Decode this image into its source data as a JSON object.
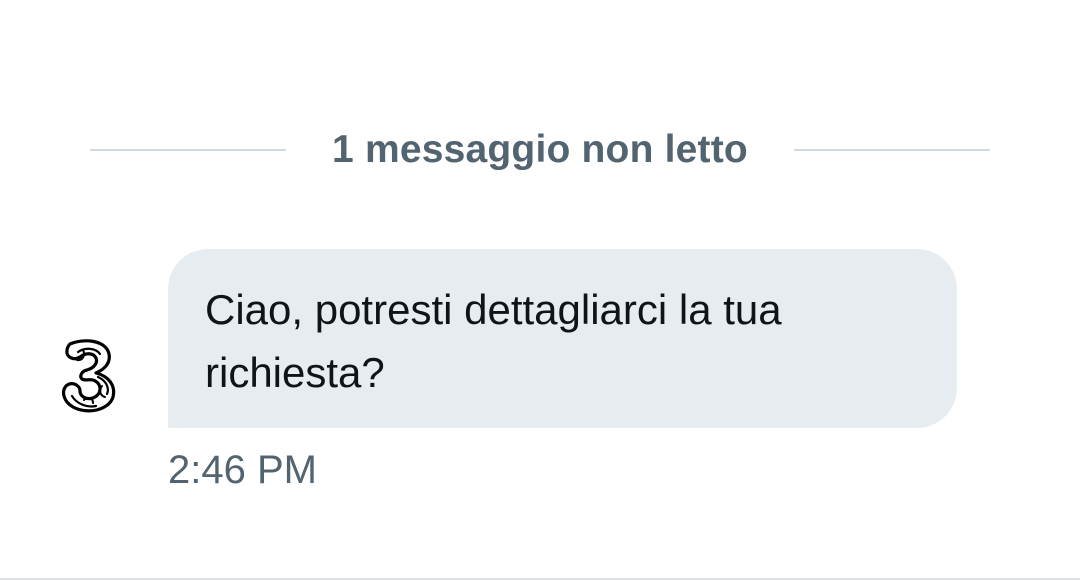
{
  "conversation": {
    "unread_divider": "1 messaggio non letto",
    "messages": [
      {
        "sender_icon": "three-logo-icon",
        "text": "Ciao, potresti dettagliarci la tua richiesta?",
        "time": "2:46 PM"
      }
    ]
  },
  "colors": {
    "bubble_background": "#e7ecf0",
    "secondary_text": "#536471",
    "primary_text": "#0f1419",
    "divider": "#cfd9de"
  }
}
